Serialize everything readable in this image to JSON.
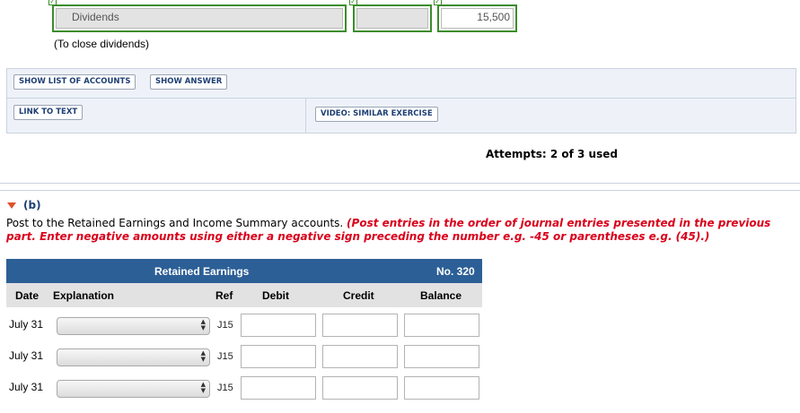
{
  "journal": {
    "account": "Dividends",
    "amount": "15,500",
    "note": "(To close dividends)",
    "check_glyph": "✓"
  },
  "buttons": {
    "show_list": "SHOW LIST OF ACCOUNTS",
    "show_answer": "SHOW ANSWER",
    "link_to_text": "LINK TO TEXT",
    "video": "VIDEO: SIMILAR EXERCISE"
  },
  "attempts": "Attempts: 2 of 3 used",
  "part": {
    "label": "(b)",
    "instruction_plain": "Post to the Retained Earnings and Income Summary accounts.",
    "instruction_red": "(Post entries in the order of journal entries presented in the previous part. Enter negative amounts using either a negative sign preceding the number e.g. -45 or parentheses e.g. (45).)"
  },
  "ledger": {
    "title": "Retained Earnings",
    "number": "No. 320",
    "columns": {
      "date": "Date",
      "explanation": "Explanation",
      "ref": "Ref",
      "debit": "Debit",
      "credit": "Credit",
      "balance": "Balance"
    },
    "rows": [
      {
        "date": "July 31",
        "ref": "J15"
      },
      {
        "date": "July 31",
        "ref": "J15"
      },
      {
        "date": "July 31",
        "ref": "J15"
      }
    ]
  }
}
